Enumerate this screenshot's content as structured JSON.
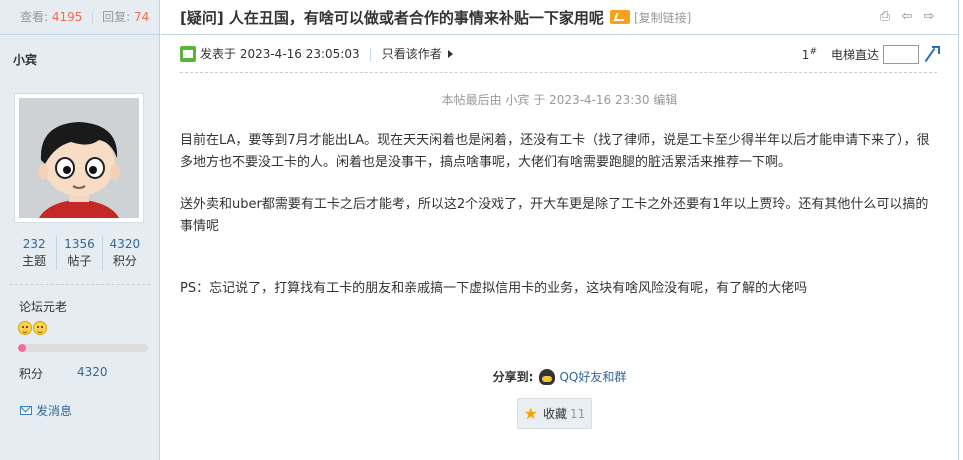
{
  "stats": {
    "views_label": "查看:",
    "views": "4195",
    "replies_label": "回复:",
    "replies": "74"
  },
  "author": {
    "name": "小宾"
  },
  "counts": [
    {
      "value": "232",
      "label": "主题"
    },
    {
      "value": "1356",
      "label": "帖子"
    },
    {
      "value": "4320",
      "label": "积分"
    }
  ],
  "rank": {
    "title": "论坛元老",
    "progress": 0.06
  },
  "score": {
    "label": "积分",
    "value": "4320"
  },
  "send_message": "发消息",
  "thread": {
    "title": "[疑问] 人在丑国，有啥可以做或者合作的事情来补贴一下家用呢",
    "copy_link": "[复制链接]"
  },
  "meta": {
    "published": "发表于 2023-4-16 23:05:03",
    "only_author": "只看该作者",
    "floor": "1",
    "floor_sup": "#",
    "elevator_label": "电梯直达"
  },
  "edited_note": "本帖最后由 小宾 于 2023-4-16 23:30 编辑",
  "content": {
    "p1": "目前在LA，要等到7月才能出LA。现在天天闲着也是闲着，还没有工卡（找了律师，说是工卡至少得半年以后才能申请下来了），很多地方也不要没工卡的人。闲着也是没事干，搞点啥事呢，大佬们有啥需要跑腿的脏活累活来推荐一下啊。",
    "p2": "送外卖和uber都需要有工卡之后才能考，所以这2个没戏了，开大车更是除了工卡之外还要有1年以上贾玲。还有其他什么可以搞的事情呢",
    "p3": "PS：忘记说了，打算找有工卡的朋友和亲戚搞一下虚拟信用卡的业务，这块有啥风险没有呢，有了解的大佬吗"
  },
  "share": {
    "label": "分享到:",
    "qq": "QQ好友和群"
  },
  "favorite": {
    "label": "收藏",
    "count": "11"
  }
}
